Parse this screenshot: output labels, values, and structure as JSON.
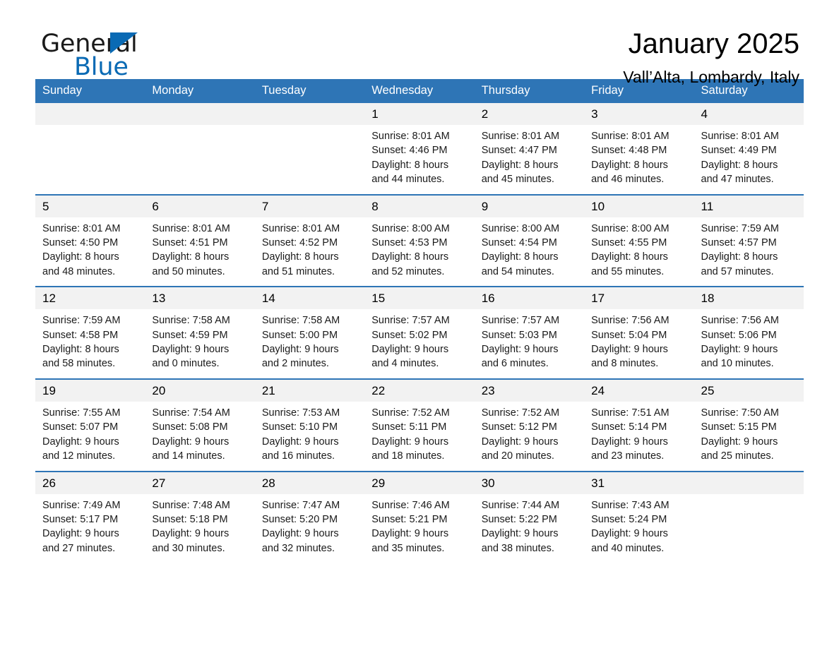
{
  "brand": {
    "name_part1": "General",
    "name_part2": "Blue",
    "triangle_color": "#0a6ab4",
    "text_color": "#1a1a1a"
  },
  "header": {
    "title": "January 2025",
    "subtitle": "Vall’Alta, Lombardy, Italy"
  },
  "theme": {
    "header_blue": "#2e75b6",
    "daynum_band": "#f2f2f2",
    "text": "#1a1a1a",
    "page_bg": "#ffffff"
  },
  "weekdays": [
    "Sunday",
    "Monday",
    "Tuesday",
    "Wednesday",
    "Thursday",
    "Friday",
    "Saturday"
  ],
  "weeks": [
    [
      {
        "day": "",
        "blank": true,
        "sunrise": "",
        "sunset": "",
        "daylight1": "",
        "daylight2": ""
      },
      {
        "day": "",
        "blank": true,
        "sunrise": "",
        "sunset": "",
        "daylight1": "",
        "daylight2": ""
      },
      {
        "day": "",
        "blank": true,
        "sunrise": "",
        "sunset": "",
        "daylight1": "",
        "daylight2": ""
      },
      {
        "day": "1",
        "blank": false,
        "sunrise": "Sunrise: 8:01 AM",
        "sunset": "Sunset: 4:46 PM",
        "daylight1": "Daylight: 8 hours",
        "daylight2": "and 44 minutes."
      },
      {
        "day": "2",
        "blank": false,
        "sunrise": "Sunrise: 8:01 AM",
        "sunset": "Sunset: 4:47 PM",
        "daylight1": "Daylight: 8 hours",
        "daylight2": "and 45 minutes."
      },
      {
        "day": "3",
        "blank": false,
        "sunrise": "Sunrise: 8:01 AM",
        "sunset": "Sunset: 4:48 PM",
        "daylight1": "Daylight: 8 hours",
        "daylight2": "and 46 minutes."
      },
      {
        "day": "4",
        "blank": false,
        "sunrise": "Sunrise: 8:01 AM",
        "sunset": "Sunset: 4:49 PM",
        "daylight1": "Daylight: 8 hours",
        "daylight2": "and 47 minutes."
      }
    ],
    [
      {
        "day": "5",
        "blank": false,
        "sunrise": "Sunrise: 8:01 AM",
        "sunset": "Sunset: 4:50 PM",
        "daylight1": "Daylight: 8 hours",
        "daylight2": "and 48 minutes."
      },
      {
        "day": "6",
        "blank": false,
        "sunrise": "Sunrise: 8:01 AM",
        "sunset": "Sunset: 4:51 PM",
        "daylight1": "Daylight: 8 hours",
        "daylight2": "and 50 minutes."
      },
      {
        "day": "7",
        "blank": false,
        "sunrise": "Sunrise: 8:01 AM",
        "sunset": "Sunset: 4:52 PM",
        "daylight1": "Daylight: 8 hours",
        "daylight2": "and 51 minutes."
      },
      {
        "day": "8",
        "blank": false,
        "sunrise": "Sunrise: 8:00 AM",
        "sunset": "Sunset: 4:53 PM",
        "daylight1": "Daylight: 8 hours",
        "daylight2": "and 52 minutes."
      },
      {
        "day": "9",
        "blank": false,
        "sunrise": "Sunrise: 8:00 AM",
        "sunset": "Sunset: 4:54 PM",
        "daylight1": "Daylight: 8 hours",
        "daylight2": "and 54 minutes."
      },
      {
        "day": "10",
        "blank": false,
        "sunrise": "Sunrise: 8:00 AM",
        "sunset": "Sunset: 4:55 PM",
        "daylight1": "Daylight: 8 hours",
        "daylight2": "and 55 minutes."
      },
      {
        "day": "11",
        "blank": false,
        "sunrise": "Sunrise: 7:59 AM",
        "sunset": "Sunset: 4:57 PM",
        "daylight1": "Daylight: 8 hours",
        "daylight2": "and 57 minutes."
      }
    ],
    [
      {
        "day": "12",
        "blank": false,
        "sunrise": "Sunrise: 7:59 AM",
        "sunset": "Sunset: 4:58 PM",
        "daylight1": "Daylight: 8 hours",
        "daylight2": "and 58 minutes."
      },
      {
        "day": "13",
        "blank": false,
        "sunrise": "Sunrise: 7:58 AM",
        "sunset": "Sunset: 4:59 PM",
        "daylight1": "Daylight: 9 hours",
        "daylight2": "and 0 minutes."
      },
      {
        "day": "14",
        "blank": false,
        "sunrise": "Sunrise: 7:58 AM",
        "sunset": "Sunset: 5:00 PM",
        "daylight1": "Daylight: 9 hours",
        "daylight2": "and 2 minutes."
      },
      {
        "day": "15",
        "blank": false,
        "sunrise": "Sunrise: 7:57 AM",
        "sunset": "Sunset: 5:02 PM",
        "daylight1": "Daylight: 9 hours",
        "daylight2": "and 4 minutes."
      },
      {
        "day": "16",
        "blank": false,
        "sunrise": "Sunrise: 7:57 AM",
        "sunset": "Sunset: 5:03 PM",
        "daylight1": "Daylight: 9 hours",
        "daylight2": "and 6 minutes."
      },
      {
        "day": "17",
        "blank": false,
        "sunrise": "Sunrise: 7:56 AM",
        "sunset": "Sunset: 5:04 PM",
        "daylight1": "Daylight: 9 hours",
        "daylight2": "and 8 minutes."
      },
      {
        "day": "18",
        "blank": false,
        "sunrise": "Sunrise: 7:56 AM",
        "sunset": "Sunset: 5:06 PM",
        "daylight1": "Daylight: 9 hours",
        "daylight2": "and 10 minutes."
      }
    ],
    [
      {
        "day": "19",
        "blank": false,
        "sunrise": "Sunrise: 7:55 AM",
        "sunset": "Sunset: 5:07 PM",
        "daylight1": "Daylight: 9 hours",
        "daylight2": "and 12 minutes."
      },
      {
        "day": "20",
        "blank": false,
        "sunrise": "Sunrise: 7:54 AM",
        "sunset": "Sunset: 5:08 PM",
        "daylight1": "Daylight: 9 hours",
        "daylight2": "and 14 minutes."
      },
      {
        "day": "21",
        "blank": false,
        "sunrise": "Sunrise: 7:53 AM",
        "sunset": "Sunset: 5:10 PM",
        "daylight1": "Daylight: 9 hours",
        "daylight2": "and 16 minutes."
      },
      {
        "day": "22",
        "blank": false,
        "sunrise": "Sunrise: 7:52 AM",
        "sunset": "Sunset: 5:11 PM",
        "daylight1": "Daylight: 9 hours",
        "daylight2": "and 18 minutes."
      },
      {
        "day": "23",
        "blank": false,
        "sunrise": "Sunrise: 7:52 AM",
        "sunset": "Sunset: 5:12 PM",
        "daylight1": "Daylight: 9 hours",
        "daylight2": "and 20 minutes."
      },
      {
        "day": "24",
        "blank": false,
        "sunrise": "Sunrise: 7:51 AM",
        "sunset": "Sunset: 5:14 PM",
        "daylight1": "Daylight: 9 hours",
        "daylight2": "and 23 minutes."
      },
      {
        "day": "25",
        "blank": false,
        "sunrise": "Sunrise: 7:50 AM",
        "sunset": "Sunset: 5:15 PM",
        "daylight1": "Daylight: 9 hours",
        "daylight2": "and 25 minutes."
      }
    ],
    [
      {
        "day": "26",
        "blank": false,
        "sunrise": "Sunrise: 7:49 AM",
        "sunset": "Sunset: 5:17 PM",
        "daylight1": "Daylight: 9 hours",
        "daylight2": "and 27 minutes."
      },
      {
        "day": "27",
        "blank": false,
        "sunrise": "Sunrise: 7:48 AM",
        "sunset": "Sunset: 5:18 PM",
        "daylight1": "Daylight: 9 hours",
        "daylight2": "and 30 minutes."
      },
      {
        "day": "28",
        "blank": false,
        "sunrise": "Sunrise: 7:47 AM",
        "sunset": "Sunset: 5:20 PM",
        "daylight1": "Daylight: 9 hours",
        "daylight2": "and 32 minutes."
      },
      {
        "day": "29",
        "blank": false,
        "sunrise": "Sunrise: 7:46 AM",
        "sunset": "Sunset: 5:21 PM",
        "daylight1": "Daylight: 9 hours",
        "daylight2": "and 35 minutes."
      },
      {
        "day": "30",
        "blank": false,
        "sunrise": "Sunrise: 7:44 AM",
        "sunset": "Sunset: 5:22 PM",
        "daylight1": "Daylight: 9 hours",
        "daylight2": "and 38 minutes."
      },
      {
        "day": "31",
        "blank": false,
        "sunrise": "Sunrise: 7:43 AM",
        "sunset": "Sunset: 5:24 PM",
        "daylight1": "Daylight: 9 hours",
        "daylight2": "and 40 minutes."
      },
      {
        "day": "",
        "blank": true,
        "sunrise": "",
        "sunset": "",
        "daylight1": "",
        "daylight2": ""
      }
    ]
  ]
}
